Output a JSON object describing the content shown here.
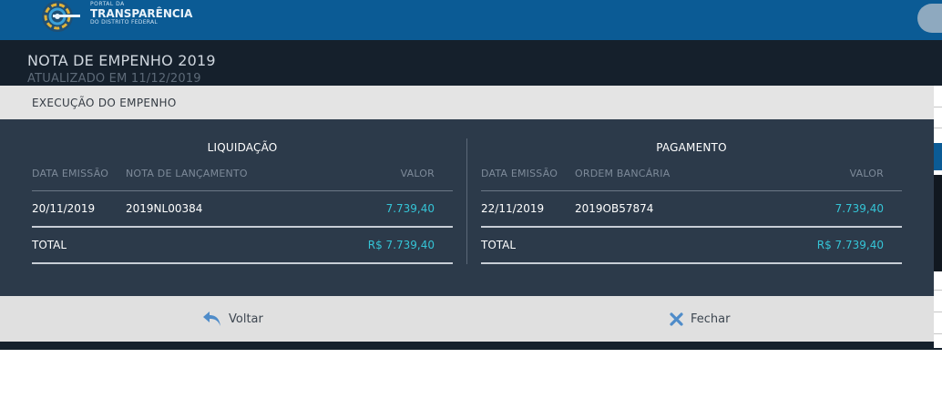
{
  "header": {
    "logo_line1": "PORTAL DA",
    "logo_line2": "TRANSPARÊNCIA",
    "logo_line3": "DO DISTRITO FEDERAL"
  },
  "page": {
    "title": "NOTA DE EMPENHO 2019",
    "subtitle": "ATUALIZADO EM 11/12/2019"
  },
  "modal": {
    "title": "EXECUÇÃO DO EMPENHO",
    "liquidacao": {
      "title": "LIQUIDAÇÃO",
      "columns": [
        "DATA EMISSÃO",
        "NOTA DE LANÇAMENTO",
        "VALOR"
      ],
      "rows": [
        {
          "data": "20/11/2019",
          "documento": "2019NL00384",
          "valor": "7.739,40"
        }
      ],
      "total_label": "TOTAL",
      "total_value": "R$ 7.739,40"
    },
    "pagamento": {
      "title": "PAGAMENTO",
      "columns": [
        "DATA EMISSÃO",
        "ORDEM BANCÁRIA",
        "VALOR"
      ],
      "rows": [
        {
          "data": "22/11/2019",
          "documento": "2019OB57874",
          "valor": "7.739,40"
        }
      ],
      "total_label": "TOTAL",
      "total_value": "R$ 7.739,40"
    },
    "footer": {
      "back_label": "Voltar",
      "back_icon": "reply-arrow-icon",
      "close_label": "Fechar",
      "close_icon": "close-x-icon"
    }
  },
  "colors": {
    "topbar": "#0b5b95",
    "modal_body": "#2c3a4a",
    "value_accent": "#35c4d6",
    "icon_accent": "#4f8cc9"
  }
}
